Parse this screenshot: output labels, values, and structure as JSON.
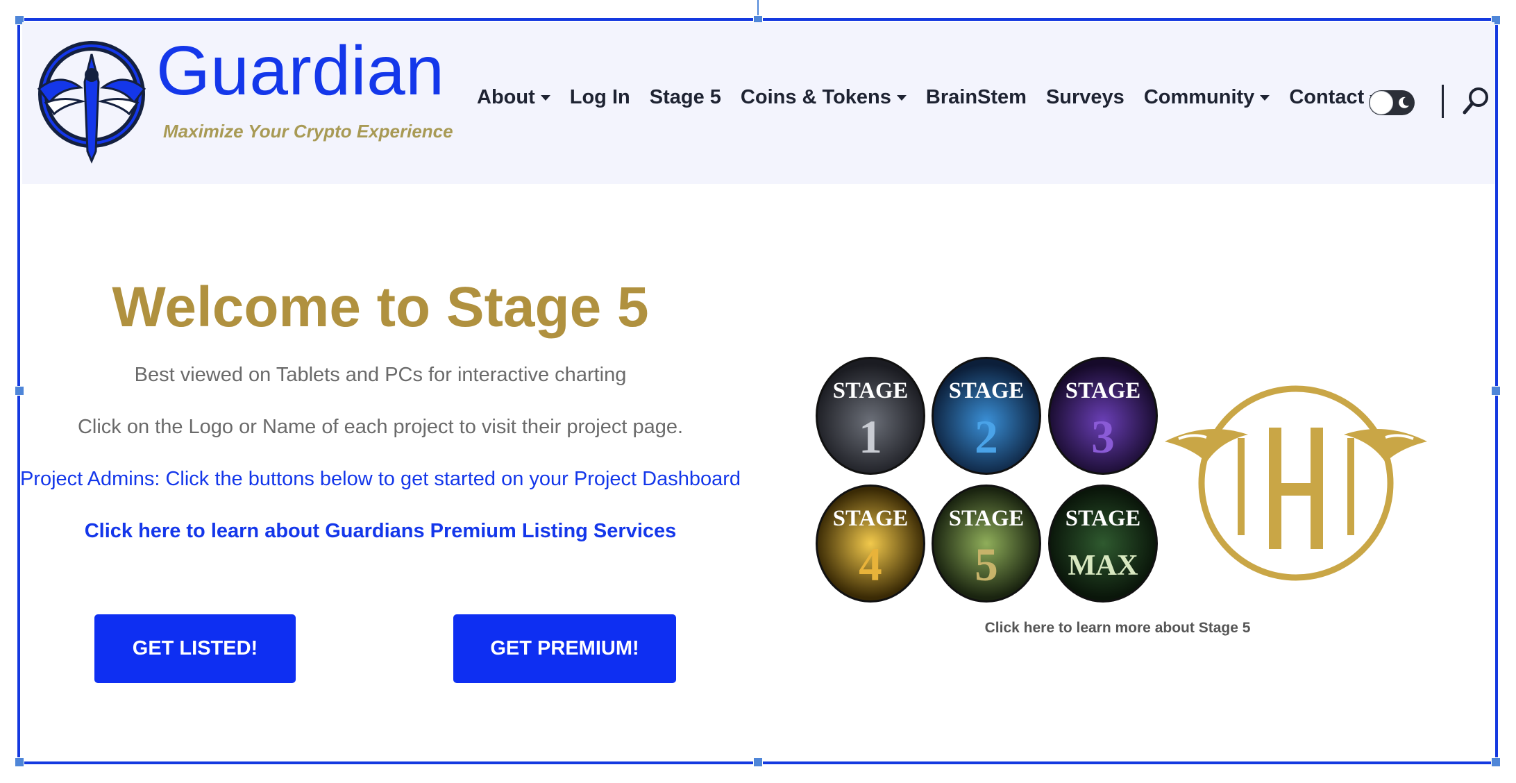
{
  "brand": {
    "name": "Guardian",
    "tagline": "Maximize Your Crypto Experience"
  },
  "nav": {
    "items": [
      {
        "label": "About",
        "dropdown": true
      },
      {
        "label": "Log In",
        "dropdown": false
      },
      {
        "label": "Stage 5",
        "dropdown": false
      },
      {
        "label": "Coins & Tokens",
        "dropdown": true
      },
      {
        "label": "BrainStem",
        "dropdown": false
      },
      {
        "label": "Surveys",
        "dropdown": false
      },
      {
        "label": "Community",
        "dropdown": true
      },
      {
        "label": "Contact",
        "dropdown": true
      }
    ],
    "theme_toggle_icon": "moon-icon",
    "search_icon": "search-icon"
  },
  "main": {
    "title": "Welcome to Stage 5",
    "subtitle": "Best viewed on Tablets and PCs for interactive charting",
    "instruction": "Click on the Logo or Name of each project to visit their project page.",
    "admin_note": "Project Admins: Click the buttons below to get started on your Project Dashboard",
    "premium_link": "Click here to learn about Guardians Premium Listing Services",
    "buttons": {
      "get_listed": "GET LISTED!",
      "get_premium": "GET PREMIUM!"
    }
  },
  "stages": {
    "badges": [
      {
        "word": "STAGE",
        "label": "1",
        "color": "#c9ccd3"
      },
      {
        "word": "STAGE",
        "label": "2",
        "color": "#4aa3e8"
      },
      {
        "word": "STAGE",
        "label": "3",
        "color": "#8a5bd6"
      },
      {
        "word": "STAGE",
        "label": "4",
        "color": "#e8b33a"
      },
      {
        "word": "STAGE",
        "label": "5",
        "color": "#7fa34a"
      },
      {
        "word": "STAGE",
        "label": "MAX",
        "color": "#5aa05a"
      }
    ],
    "caption": "Click here to learn more about Stage 5"
  },
  "colors": {
    "brand_blue": "#1437ea",
    "gold": "#b0913f",
    "button_blue": "#0e2ff2"
  }
}
